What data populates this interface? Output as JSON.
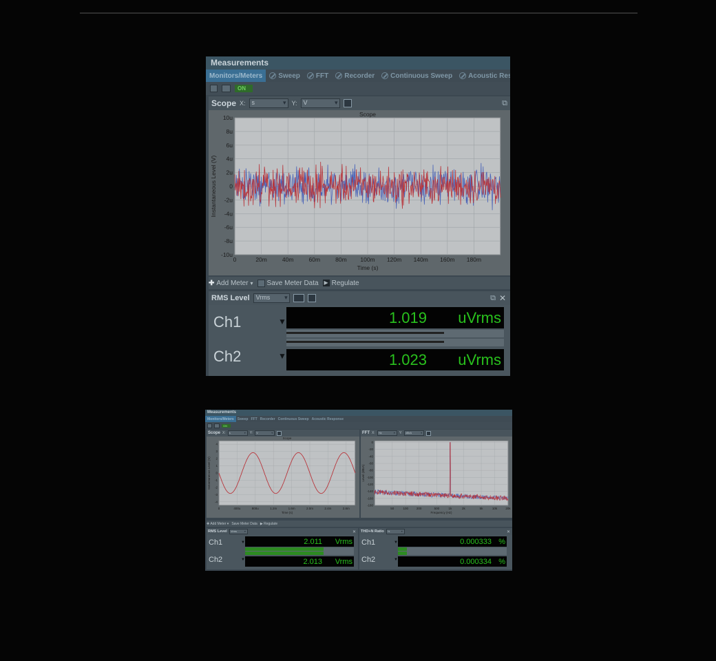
{
  "shot1": {
    "title": "Measurements",
    "tabs": [
      {
        "label": "Monitors/Meters",
        "active": true
      },
      {
        "label": "Sweep"
      },
      {
        "label": "FFT"
      },
      {
        "label": "Recorder"
      },
      {
        "label": "Continuous Sweep"
      },
      {
        "label": "Acoustic Respons"
      }
    ],
    "on_label": "ON",
    "scope": {
      "label": "Scope",
      "x_label": "X:",
      "x_unit": "s",
      "y_label": "Y:",
      "y_unit": "V"
    },
    "meter_toolbar": {
      "add_meter": "Add Meter",
      "save_meter_data": "Save Meter Data",
      "regulate": "Regulate"
    },
    "rms": {
      "label": "RMS Level",
      "unit": "Vrms",
      "channels": [
        {
          "name": "Ch1",
          "value": "1.019",
          "unit": "uVrms",
          "level": 0.76
        },
        {
          "name": "Ch2",
          "value": "1.023",
          "unit": "uVrms",
          "level": 0.76
        }
      ]
    }
  },
  "shot2": {
    "title": "Measurements",
    "tabs": [
      {
        "label": "Monitors/Meters",
        "active": true
      },
      {
        "label": "Sweep"
      },
      {
        "label": "FFT"
      },
      {
        "label": "Recorder"
      },
      {
        "label": "Continuous Sweep"
      },
      {
        "label": "Acoustic Response"
      }
    ],
    "on_label": "ON",
    "scope": {
      "label": "Scope",
      "x_label": "X:",
      "x_unit": "s",
      "y_label": "Y:",
      "y_unit": "V"
    },
    "fft": {
      "label": "FFT",
      "x_label": "X:",
      "x_unit": "Hz",
      "y_label": "Y:",
      "y_unit": "dBrA"
    },
    "meter_toolbar": {
      "add_meter": "Add Meter",
      "save_meter_data": "Save Meter Data",
      "regulate": "Regulate"
    },
    "rms": {
      "label": "RMS Level",
      "unit": "Vrms",
      "channels": [
        {
          "name": "Ch1",
          "value": "2.011",
          "unit": "Vrms",
          "level": 0.72
        },
        {
          "name": "Ch2",
          "value": "2.013",
          "unit": "Vrms",
          "level": 0.72
        }
      ]
    },
    "thdn": {
      "label": "THD+N Ratio",
      "unit": "%",
      "channels": [
        {
          "name": "Ch1",
          "value": "0.000333",
          "unit": "%",
          "level": 0.08
        },
        {
          "name": "Ch2",
          "value": "0.000334",
          "unit": "%",
          "level": 0.08
        }
      ]
    }
  },
  "chart_data": [
    {
      "type": "line",
      "title": "Scope",
      "xlabel": "Time (s)",
      "ylabel": "Instantaneous Level (V)",
      "x_ticks": [
        "0",
        "20m",
        "40m",
        "60m",
        "80m",
        "100m",
        "120m",
        "140m",
        "160m",
        "180m"
      ],
      "y_ticks": [
        "10u",
        "8u",
        "6u",
        "4u",
        "2u",
        "0",
        "-2u",
        "-4u",
        "-6u",
        "-8u",
        "-10u"
      ],
      "xlim": [
        0,
        0.2
      ],
      "ylim": [
        -1e-05,
        1e-05
      ],
      "series": [
        {
          "color": "#4a63b8",
          "description": "noise, approx ±3u"
        },
        {
          "color": "#b8343a",
          "description": "noise, approx ±3u"
        }
      ],
      "grid": true
    },
    {
      "type": "line",
      "title": "Scope",
      "xlabel": "Time (s)",
      "ylabel": "Instantaneous Level (V)",
      "x_ticks": [
        "0",
        "400u",
        "800u",
        "1.2m",
        "1.6m",
        "2.0m",
        "2.4m",
        "2.8m"
      ],
      "y_ticks": [
        "4",
        "3",
        "2",
        "1",
        "0",
        "-1",
        "-2",
        "-3",
        "-4"
      ],
      "xlim": [
        0,
        0.003
      ],
      "ylim": [
        -4.5,
        4.5
      ],
      "series": [
        {
          "color": "#b8343a",
          "amplitude": 2.84,
          "frequency_hz": 1000
        }
      ],
      "grid": true
    },
    {
      "type": "line",
      "title": "",
      "xlabel": "Frequency (Hz)",
      "ylabel": "Level (dBrA)",
      "x_ticks": [
        "50",
        "100",
        "200",
        "500",
        "1k",
        "2k",
        "5k",
        "10k",
        "20k"
      ],
      "y_ticks": [
        "0",
        "-20",
        "-40",
        "-60",
        "-80",
        "-100",
        "-120",
        "-140",
        "-160",
        "-180"
      ],
      "xlim": [
        20,
        20000
      ],
      "ylim": [
        -180,
        5
      ],
      "x_scale": "log",
      "series": [
        {
          "color": "#b8343a",
          "peak_hz": 1000,
          "peak_db": 0,
          "noise_floor_db": -150
        },
        {
          "color": "#4a63b8",
          "peak_hz": 1000,
          "peak_db": 0,
          "noise_floor_db": -150
        }
      ],
      "grid": true
    }
  ]
}
